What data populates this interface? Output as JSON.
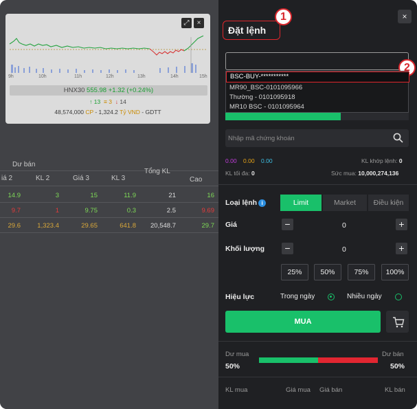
{
  "chart": {
    "times": [
      "9h",
      "10h",
      "11h",
      "12h",
      "13h",
      "14h",
      "15h"
    ],
    "index_name": "HNX30",
    "index_value": "555.98",
    "index_change": "+1.32 (+0.24%)",
    "up_count": "13",
    "flat_count": "3",
    "down_count": "14",
    "volume_text": "48,574,000",
    "cp_label": "CP",
    "value_text": "- 1,324.2",
    "unit_label": "Tỷ VND",
    "suffix": "- GDTT"
  },
  "table": {
    "group_header": "Dư bán",
    "headers": [
      "iá 2",
      "KL 2",
      "Giá 3",
      "KL 3",
      "Tổng KL",
      "Cao"
    ],
    "rows": [
      {
        "c1": "14.9",
        "c2": "3",
        "c3": "15",
        "c4": "11.9",
        "c5": "21",
        "c6": "16",
        "color": "#7ed957"
      },
      {
        "c1": "9.7",
        "c2": "1",
        "c3": "9.75",
        "c4": "0.3",
        "c5": "2.5",
        "c6": "9.69",
        "color": "#e23b3b"
      },
      {
        "c1": "29.6",
        "c2": "1,323.4",
        "c3": "29.65",
        "c4": "641.8",
        "c5": "20,548.7",
        "c6": "29.7",
        "color": "#d8a73a"
      }
    ]
  },
  "order": {
    "title": "Đặt lệnh",
    "close_icon": "×",
    "badge1": "1",
    "badge2": "2",
    "accounts": [
      "BSC-BUY-***********",
      "MR90_BSC-0101095966",
      "Thường - 0101095918",
      "MR10 BSC - 0101095964"
    ],
    "search_placeholder": "Nhập mã chứng khoán",
    "price_ceiling": "0.00",
    "price_ref": "0.00",
    "price_floor": "0.00",
    "matched_label": "KL khớp lệnh:",
    "matched_value": "0",
    "max_label": "KL tối đa:",
    "max_value": "0",
    "power_label": "Sức mua:",
    "power_value": "10,000,274,136",
    "order_type_label": "Loại lệnh",
    "order_types": [
      "Limit",
      "Market",
      "Điều kiện"
    ],
    "price_label": "Giá",
    "price_value": "0",
    "qty_label": "Khối lượng",
    "qty_value": "0",
    "percents": [
      "25%",
      "50%",
      "75%",
      "100%"
    ],
    "validity_label": "Hiệu lực",
    "validity_options": [
      "Trong ngày",
      "Nhiều ngày"
    ],
    "buy_label": "MUA",
    "bid_label": "Dư mua",
    "ask_label": "Dư bán",
    "bid_pct": "50%",
    "ask_pct": "50%",
    "bid_ratio": 0.5,
    "col_headers": [
      "KL mua",
      "Giá mua",
      "Giá bán",
      "KL bán"
    ]
  }
}
